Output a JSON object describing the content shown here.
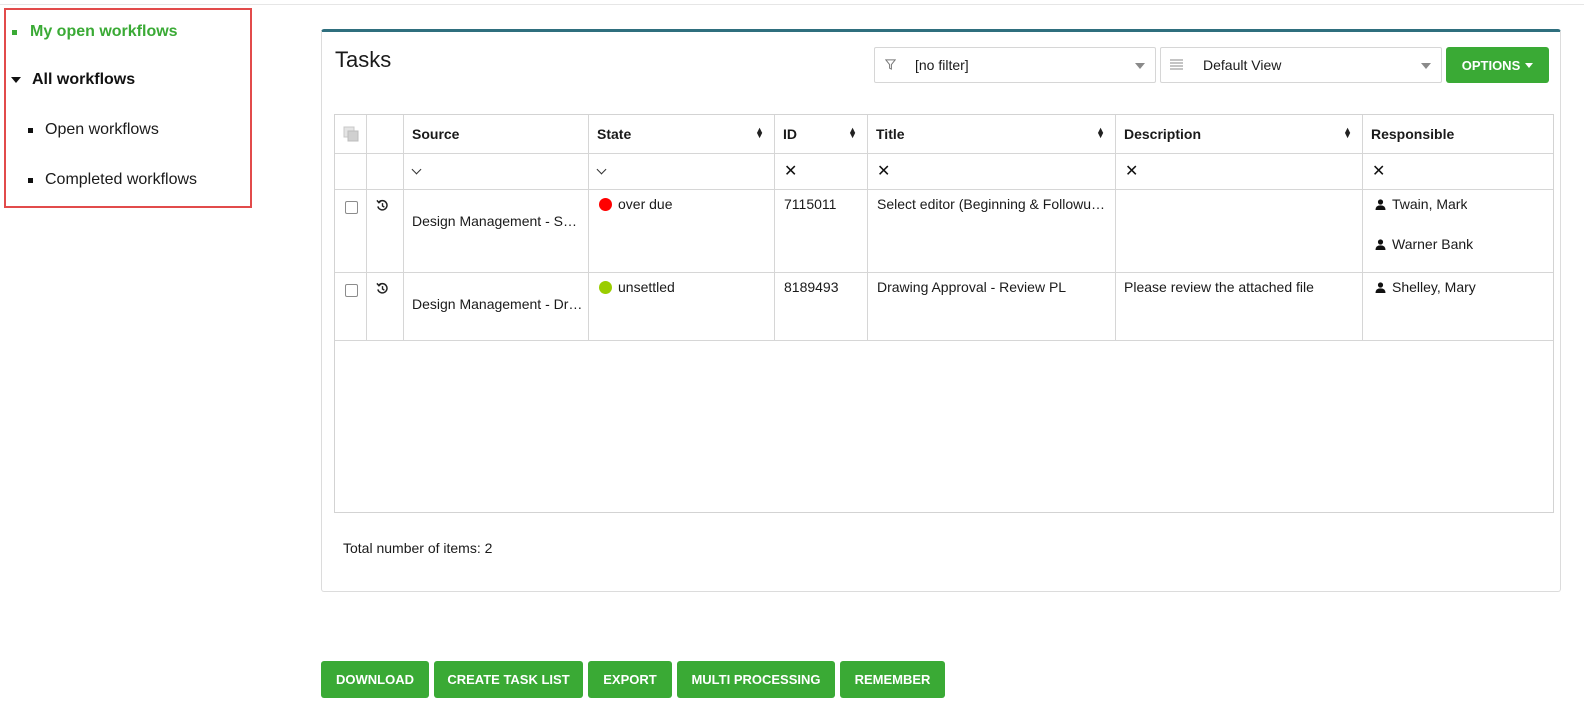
{
  "sidebar": {
    "items": [
      {
        "label": "My open workflows"
      },
      {
        "label": "All workflows"
      },
      {
        "label": "Open workflows"
      },
      {
        "label": "Completed workflows"
      }
    ]
  },
  "tasks": {
    "title": "Tasks",
    "filter_value": "[no filter]",
    "view_value": "Default View",
    "options_label": "OPTIONS",
    "columns": {
      "source": "Source",
      "state": "State",
      "id": "ID",
      "title": "Title",
      "description": "Description",
      "responsible": "Responsible"
    },
    "rows": [
      {
        "source": "Design Management - Sel…",
        "state": "over due",
        "state_color": "#ff0000",
        "id": "7115011",
        "title": "Select editor (Beginning & Followu…",
        "description": "",
        "responsible": [
          "Twain, Mark",
          "Warner Bank"
        ]
      },
      {
        "source": "Design Management - Dr…",
        "state": "unsettled",
        "state_color": "#9acd00",
        "id": "8189493",
        "title": "Drawing Approval - Review PL",
        "description": "Please review the attached file",
        "responsible": [
          "Shelley, Mary"
        ]
      }
    ],
    "total_label": "Total number of items: 2"
  },
  "actions": {
    "download": "DOWNLOAD",
    "create_task_list": "CREATE TASK LIST",
    "export": "EXPORT",
    "multi_processing": "MULTI PROCESSING",
    "remember": "REMEMBER"
  },
  "colors": {
    "accent_green": "#3aaa35",
    "panel_top_border": "#2f6f7e",
    "highlight_box": "#e24b4b"
  }
}
